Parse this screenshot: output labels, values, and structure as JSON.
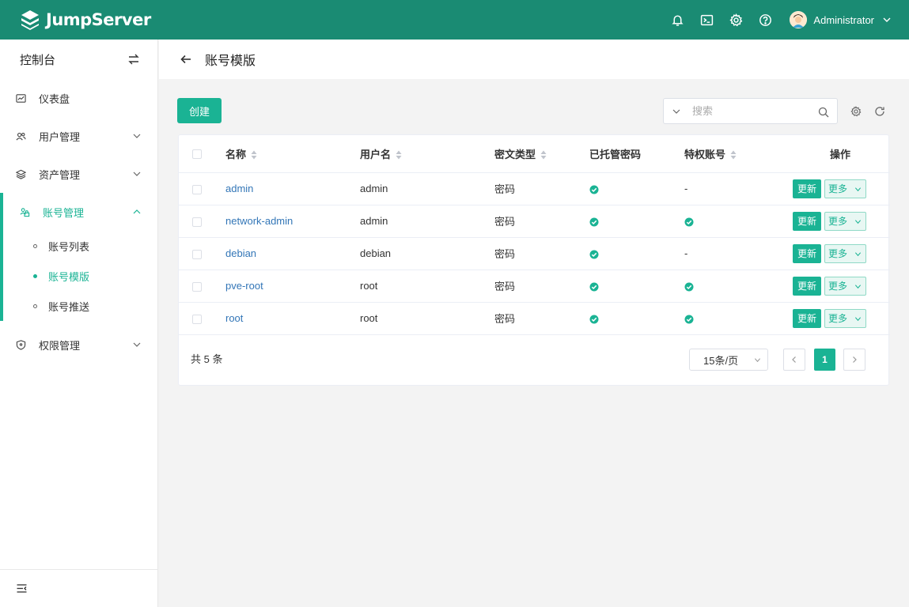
{
  "brand": {
    "name": "JumpServer"
  },
  "header": {
    "user_name": "Administrator"
  },
  "sidebar": {
    "title": "控制台",
    "items": [
      {
        "label": "仪表盘"
      },
      {
        "label": "用户管理"
      },
      {
        "label": "资产管理"
      },
      {
        "label": "账号管理",
        "children": [
          {
            "label": "账号列表"
          },
          {
            "label": "账号模版"
          },
          {
            "label": "账号推送"
          }
        ]
      },
      {
        "label": "权限管理"
      }
    ]
  },
  "page": {
    "title": "账号模版"
  },
  "toolbar": {
    "create_label": "创建",
    "search_placeholder": "搜索"
  },
  "table": {
    "columns": [
      "名称",
      "用户名",
      "密文类型",
      "已托管密码",
      "特权账号",
      "操作"
    ],
    "rows": [
      {
        "name": "admin",
        "username": "admin",
        "secret_type": "密码",
        "privileged": "-"
      },
      {
        "name": "network-admin",
        "username": "admin",
        "secret_type": "密码",
        "privileged": ""
      },
      {
        "name": "debian",
        "username": "debian",
        "secret_type": "密码",
        "privileged": "-"
      },
      {
        "name": "pve-root",
        "username": "root",
        "secret_type": "密码",
        "privileged": ""
      },
      {
        "name": "root",
        "username": "root",
        "secret_type": "密码",
        "privileged": ""
      }
    ],
    "update_label": "更新",
    "more_label": "更多"
  },
  "pagination": {
    "total": "共 5 条",
    "page_size": "15条/页",
    "current_page": "1"
  },
  "colors": {
    "header_bg": "#1a8b73",
    "accent": "#1ab394",
    "link": "#3376b7"
  }
}
